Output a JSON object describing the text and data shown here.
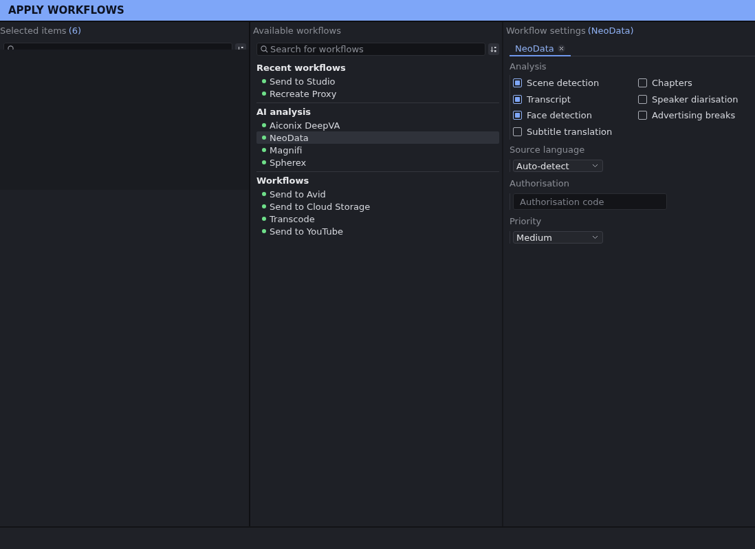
{
  "title": "APPLY WORKFLOWS",
  "selected_items": {
    "label": "Selected items",
    "count": "(6)"
  },
  "available_workflows": {
    "label": "Available workflows",
    "search": {
      "placeholder": "Search for workflows"
    },
    "groups": [
      {
        "title": "Recent workflows",
        "items": [
          {
            "label": "Send to Studio",
            "selected": false
          },
          {
            "label": "Recreate Proxy",
            "selected": false
          }
        ]
      },
      {
        "title": "AI analysis",
        "items": [
          {
            "label": "Aiconix DeepVA",
            "selected": false
          },
          {
            "label": "NeoData",
            "selected": true
          },
          {
            "label": "Magnifi",
            "selected": false
          },
          {
            "label": "Spherex",
            "selected": false
          }
        ]
      },
      {
        "title": "Workflows",
        "items": [
          {
            "label": "Send to Avid",
            "selected": false
          },
          {
            "label": "Send to Cloud Storage",
            "selected": false
          },
          {
            "label": "Transcode",
            "selected": false
          },
          {
            "label": "Send to YouTube",
            "selected": false
          }
        ]
      }
    ]
  },
  "workflow_settings": {
    "label": "Workflow settings",
    "workflow": "(NeoData)",
    "tabs": [
      {
        "label": "NeoData",
        "selected": true
      }
    ],
    "sections": [
      {
        "kind": "checkboxes",
        "label": "Analysis",
        "options": [
          {
            "label": "Scene detection",
            "checked": true
          },
          {
            "label": "Transcript",
            "checked": true
          },
          {
            "label": "Face detection",
            "checked": true
          },
          {
            "label": "Subtitle translation",
            "checked": false
          },
          {
            "label": "Chapters",
            "checked": false
          },
          {
            "label": "Speaker diarisation",
            "checked": false
          },
          {
            "label": "Advertising breaks",
            "checked": false
          }
        ]
      },
      {
        "kind": "select",
        "label": "Source language",
        "value": "Auto-detect"
      },
      {
        "kind": "input",
        "label": "Authorisation",
        "placeholder": "Authorisation code"
      },
      {
        "kind": "select",
        "label": "Priority",
        "value": "Medium"
      }
    ]
  }
}
